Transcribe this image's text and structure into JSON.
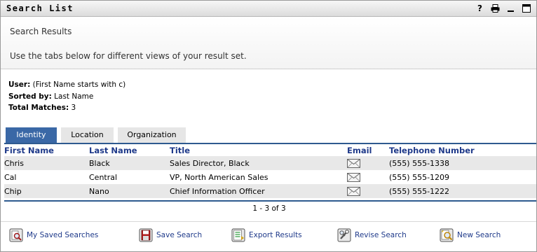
{
  "window": {
    "title": "Search List",
    "controls": [
      "help-icon",
      "print-icon",
      "minimize-icon",
      "maximize-icon"
    ]
  },
  "header": {
    "page_title": "Search Results",
    "instructions": "Use the tabs below for different views of your result set."
  },
  "summary": {
    "user_label": "User:",
    "user_value": " (First Name starts with c)",
    "sorted_label": "Sorted by:",
    "sorted_value": " Last Name",
    "matches_label": "Total Matches:",
    "matches_value": " 3"
  },
  "tabs": [
    {
      "label": "Identity",
      "active": true
    },
    {
      "label": "Location",
      "active": false
    },
    {
      "label": "Organization",
      "active": false
    }
  ],
  "table": {
    "columns": [
      "First Name",
      "Last Name",
      "Title",
      "Email",
      "Telephone Number"
    ],
    "rows": [
      {
        "first": "Chris",
        "last": "Black",
        "title": "Sales Director, Black",
        "email_icon": "envelope-icon",
        "phone": "(555) 555-1338"
      },
      {
        "first": "Cal",
        "last": "Central",
        "title": "VP, North American Sales",
        "email_icon": "envelope-icon",
        "phone": "(555) 555-1209"
      },
      {
        "first": "Chip",
        "last": "Nano",
        "title": "Chief Information Officer",
        "email_icon": "envelope-icon",
        "phone": "(555) 555-1222"
      }
    ]
  },
  "pager": "1 - 3 of 3",
  "footer_actions": [
    {
      "label": "My Saved Searches",
      "icon": "saved-searches-icon"
    },
    {
      "label": "Save Search",
      "icon": "floppy-disk-icon"
    },
    {
      "label": "Export Results",
      "icon": "export-icon"
    },
    {
      "label": "Revise Search",
      "icon": "revise-icon"
    },
    {
      "label": "New Search",
      "icon": "new-search-icon"
    }
  ],
  "colors": {
    "accent_blue": "#3a68a6",
    "link_blue": "#1f3a8a",
    "row_shade": "#e8e8e8"
  }
}
